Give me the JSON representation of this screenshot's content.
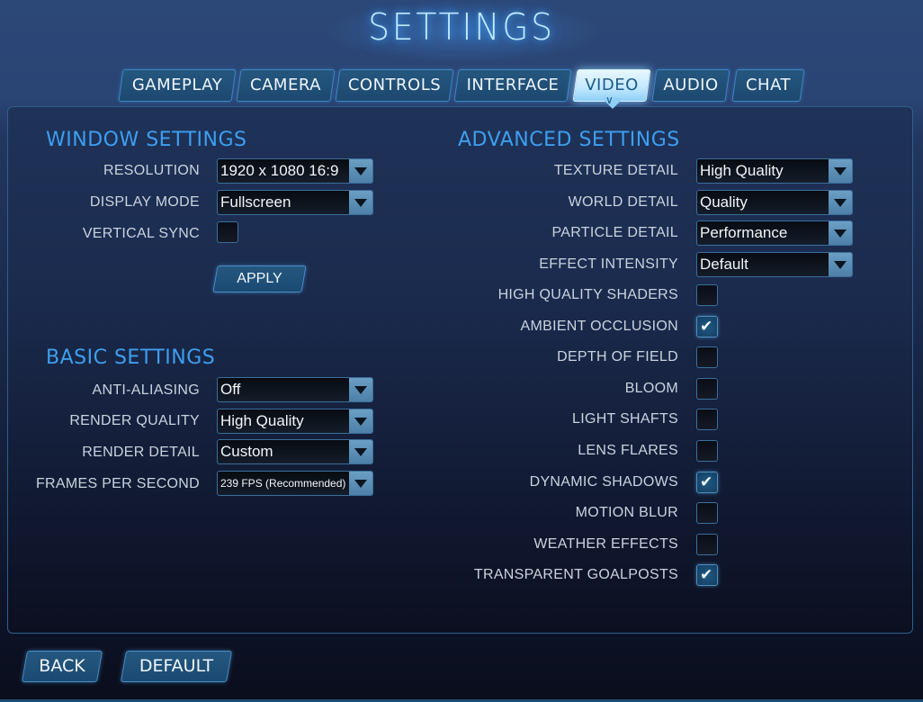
{
  "title": "SETTINGS",
  "tabs": [
    {
      "label": "GAMEPLAY",
      "active": false
    },
    {
      "label": "CAMERA",
      "active": false
    },
    {
      "label": "CONTROLS",
      "active": false
    },
    {
      "label": "INTERFACE",
      "active": false
    },
    {
      "label": "VIDEO",
      "active": true
    },
    {
      "label": "AUDIO",
      "active": false
    },
    {
      "label": "CHAT",
      "active": false
    }
  ],
  "window_settings": {
    "title": "WINDOW SETTINGS",
    "resolution": {
      "label": "RESOLUTION",
      "value": "1920 x 1080 16:9"
    },
    "display_mode": {
      "label": "DISPLAY MODE",
      "value": "Fullscreen"
    },
    "vertical_sync": {
      "label": "VERTICAL SYNC",
      "checked": false
    },
    "apply_label": "APPLY"
  },
  "basic_settings": {
    "title": "BASIC SETTINGS",
    "anti_aliasing": {
      "label": "ANTI-ALIASING",
      "value": "Off"
    },
    "render_quality": {
      "label": "RENDER QUALITY",
      "value": "High Quality"
    },
    "render_detail": {
      "label": "RENDER DETAIL",
      "value": "Custom"
    },
    "fps": {
      "label": "FRAMES PER SECOND",
      "value": "239  FPS (Recommended)"
    }
  },
  "advanced_settings": {
    "title": "ADVANCED SETTINGS",
    "dropdowns": [
      {
        "label": "TEXTURE DETAIL",
        "value": "High Quality"
      },
      {
        "label": "WORLD DETAIL",
        "value": "Quality"
      },
      {
        "label": "PARTICLE DETAIL",
        "value": "Performance"
      },
      {
        "label": "EFFECT INTENSITY",
        "value": "Default"
      }
    ],
    "checkboxes": [
      {
        "label": "HIGH QUALITY SHADERS",
        "checked": false
      },
      {
        "label": "AMBIENT OCCLUSION",
        "checked": true
      },
      {
        "label": "DEPTH OF FIELD",
        "checked": false
      },
      {
        "label": "BLOOM",
        "checked": false
      },
      {
        "label": "LIGHT SHAFTS",
        "checked": false
      },
      {
        "label": "LENS FLARES",
        "checked": false
      },
      {
        "label": "DYNAMIC SHADOWS",
        "checked": true
      },
      {
        "label": "MOTION BLUR",
        "checked": false
      },
      {
        "label": "WEATHER EFFECTS",
        "checked": false
      },
      {
        "label": "TRANSPARENT GOALPOSTS",
        "checked": true
      }
    ]
  },
  "footer": {
    "back_label": "BACK",
    "default_label": "DEFAULT"
  },
  "icons": {
    "check": "✔"
  }
}
